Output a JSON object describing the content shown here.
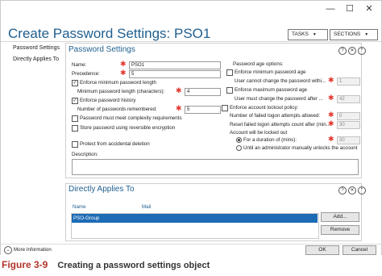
{
  "window": {
    "minimize": "—",
    "maximize": "☐",
    "close": "✕"
  },
  "title": "Create Password Settings: PSO1",
  "top_buttons": {
    "tasks": "TASKS",
    "sections": "SECTIONS",
    "arrow": "▼"
  },
  "nav": {
    "items": [
      {
        "label": "Password Settings"
      },
      {
        "label": "Directly Applies To"
      }
    ]
  },
  "password_settings": {
    "header": "Password Settings",
    "header_icons": {
      "help": "?",
      "close": "✕",
      "collapse": "⌃"
    },
    "name": {
      "label": "Name:",
      "value": "PSO1"
    },
    "precedence": {
      "label": "Precedence:",
      "value": "5"
    },
    "enforce_min_length": {
      "label": "Enforce minimum password length",
      "checked": true
    },
    "min_length": {
      "label": "Minimum password length (characters):",
      "value": "4"
    },
    "enforce_history": {
      "label": "Enforce password history",
      "checked": true
    },
    "history": {
      "label": "Number of passwords remembered:",
      "value": "5"
    },
    "complexity": {
      "label": "Password must meet complexity requirements",
      "checked": false
    },
    "reversible": {
      "label": "Store password using reversible encryption",
      "checked": false
    },
    "protect": {
      "label": "Protect from accidental deletion",
      "checked": false
    },
    "description": {
      "label": "Description:",
      "value": ""
    },
    "age_options": {
      "label": "Password age options:",
      "enforce_min_age": {
        "label": "Enforce minimum password age",
        "checked": false
      },
      "min_age": {
        "label": "User cannot change the password withi...",
        "value": "1"
      },
      "enforce_max_age": {
        "label": "Enforce maximum password age",
        "checked": false
      },
      "max_age": {
        "label": "User must change the password after ...",
        "value": "42"
      }
    },
    "lockout": {
      "label": "Enforce account lockout policy:",
      "checked": false,
      "failed_attempts": {
        "label": "Number of failed logon attempts allowed:",
        "value": "0"
      },
      "reset_after": {
        "label": "Reset failed logon attempts count after (min...",
        "value": "30"
      },
      "locked_out_label": "Account will be locked out",
      "duration": {
        "label": "For a duration of (mins):",
        "value": "30",
        "selected": true
      },
      "until_unlock": {
        "label": "Until an administrator manually unlocks the account",
        "selected": false
      }
    }
  },
  "directly_applies": {
    "header": "Directly Applies To",
    "columns": [
      "Name",
      "Mail"
    ],
    "rows": [
      {
        "name": "PSO-Group",
        "mail": "",
        "selected": true
      }
    ],
    "add_button": "Add...",
    "remove_button": "Remove"
  },
  "footer": {
    "more_info": "More Information",
    "more_icon": "⌄",
    "ok": "OK",
    "cancel": "Cancel"
  },
  "caption": {
    "number": "Figure 3-9",
    "text": "Creating a password settings object"
  },
  "colors": {
    "accent": "#1f5f8f",
    "selection": "#1d6bb5",
    "required": "#e0392f",
    "caption_red": "#b0342c"
  }
}
